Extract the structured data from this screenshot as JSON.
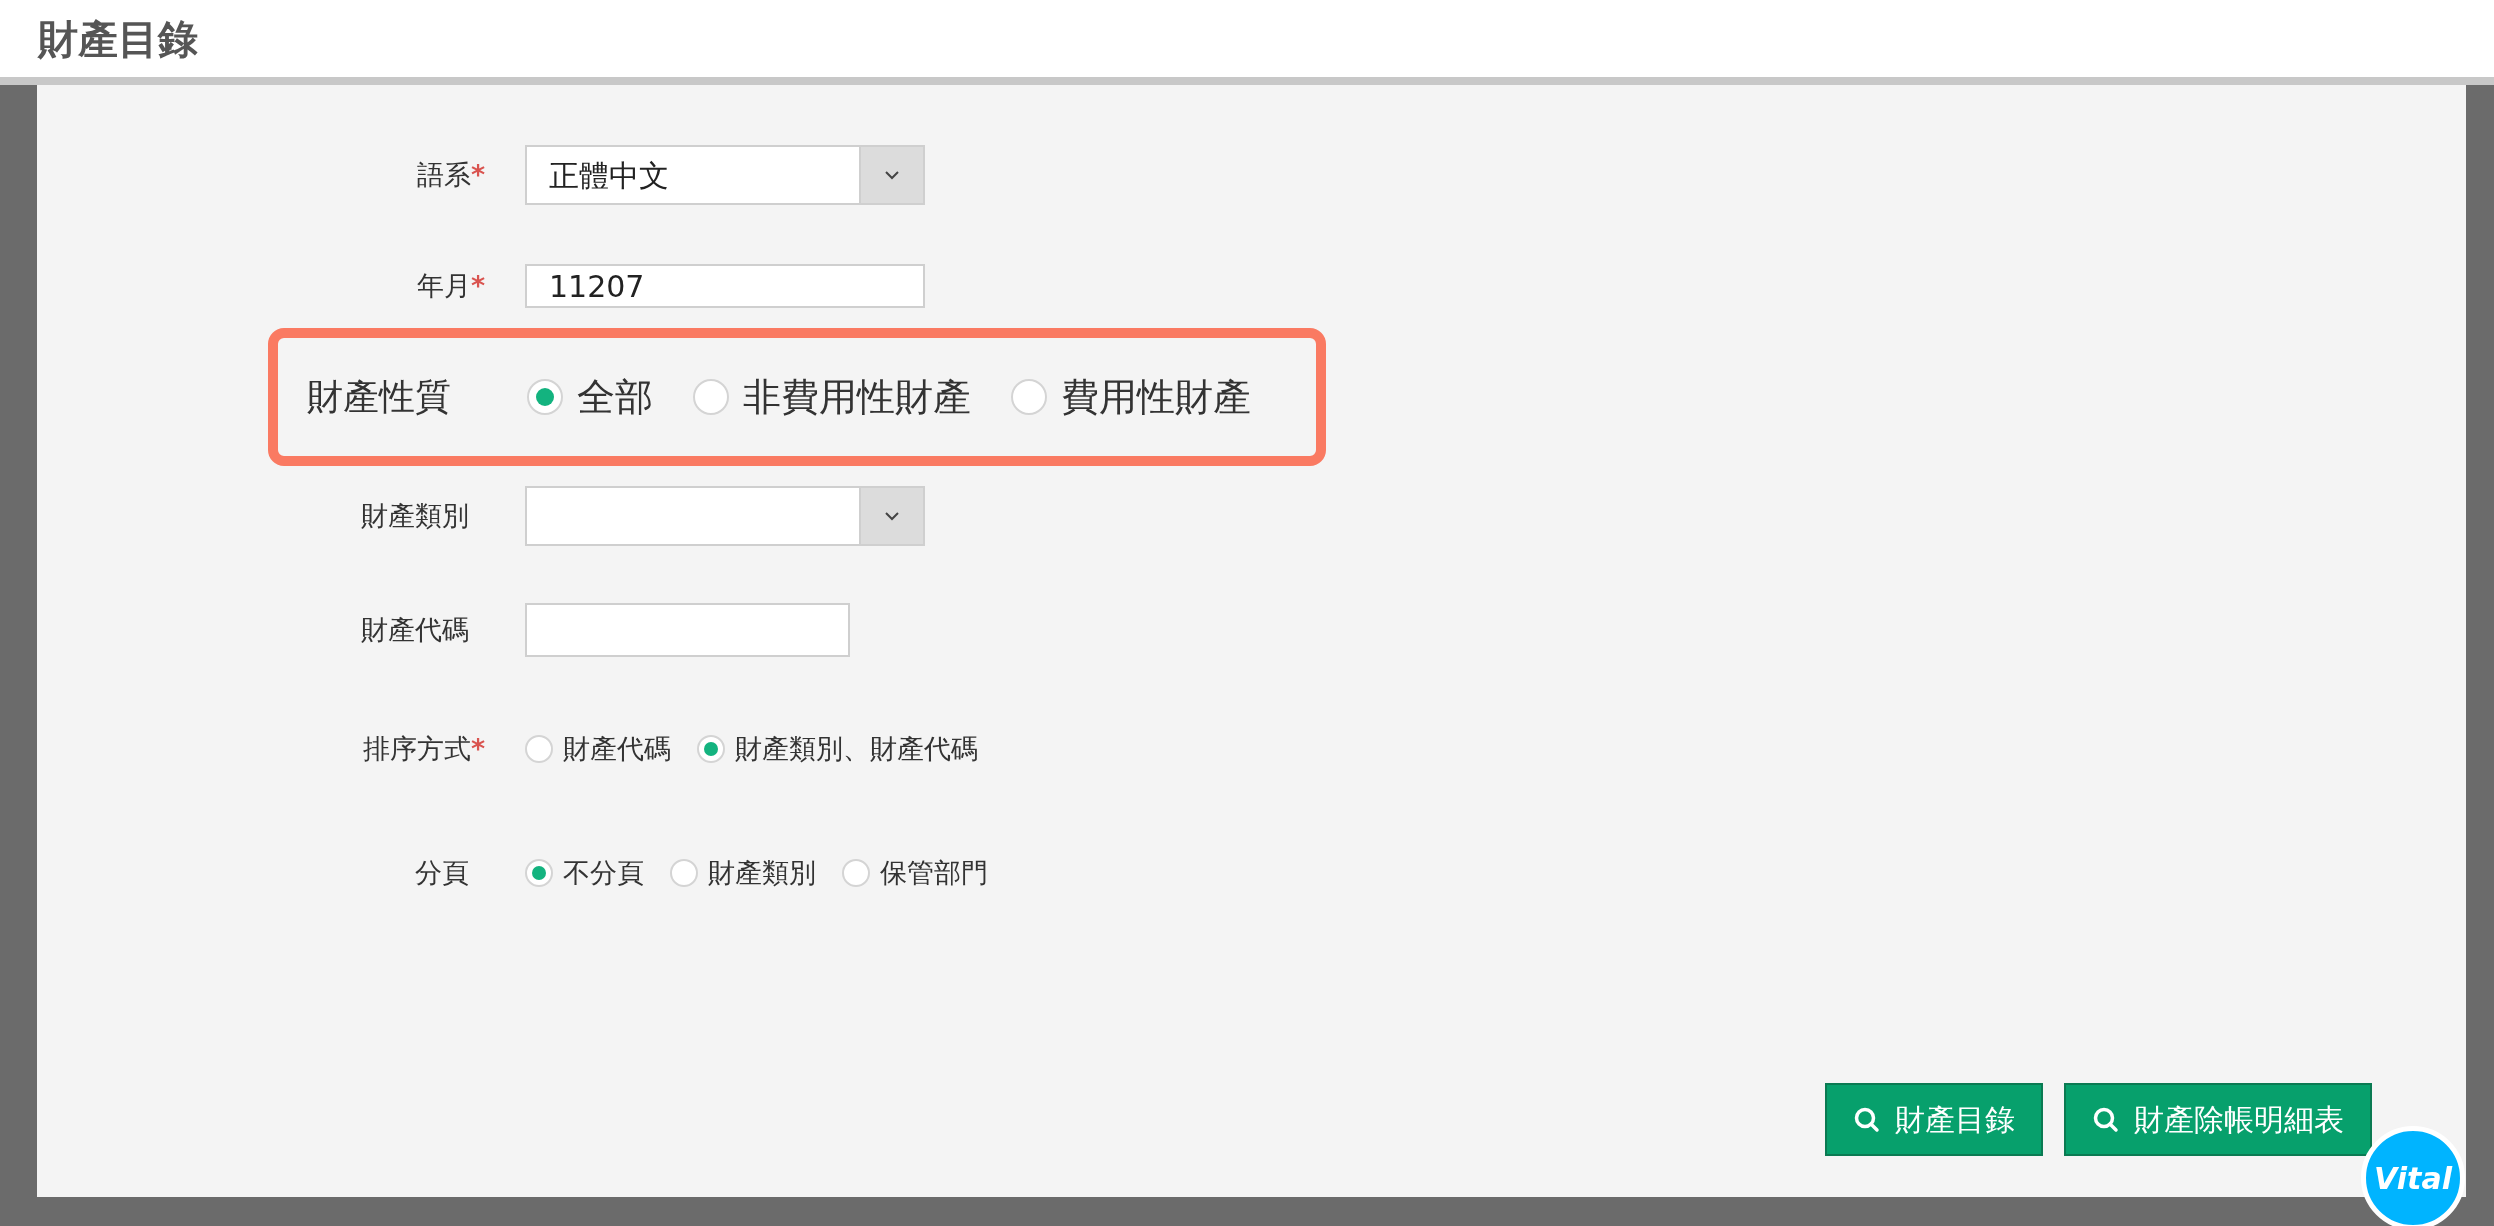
{
  "title": "財產目錄",
  "fields": [
    {
      "kind": "select",
      "label": "語系",
      "required_mark": "*",
      "highlighted": false,
      "value": "正體中文"
    },
    {
      "kind": "text",
      "label": "年月",
      "required_mark": "*",
      "highlighted": false,
      "value": "11207"
    },
    {
      "kind": "radio",
      "label": "財產性質",
      "highlighted": true,
      "options": [
        {
          "label": "全部",
          "selected": true
        },
        {
          "label": "非費用性財產",
          "selected": false
        },
        {
          "label": "費用性財產",
          "selected": false
        }
      ]
    },
    {
      "kind": "select",
      "label": "財產類別",
      "highlighted": false
    },
    {
      "kind": "text",
      "label": "財產代碼",
      "highlighted": false
    },
    {
      "kind": "radio",
      "label": "排序方式",
      "required_mark": "*",
      "highlighted": false,
      "options": [
        {
          "label": "財產代碼",
          "selected": false
        },
        {
          "label": "財產類別、財產代碼",
          "selected": true
        }
      ]
    },
    {
      "kind": "radio",
      "label": "分頁",
      "highlighted": false,
      "options": [
        {
          "label": "不分頁",
          "selected": true
        },
        {
          "label": "財產類別",
          "selected": false
        },
        {
          "label": "保管部門",
          "selected": false
        }
      ]
    }
  ],
  "buttons": [
    "財產目錄",
    "財產除帳明細表"
  ],
  "logo": {
    "text": "Vital"
  }
}
